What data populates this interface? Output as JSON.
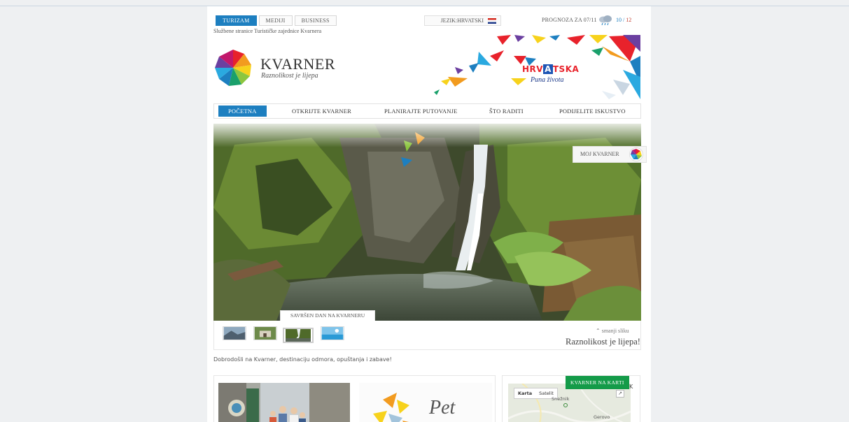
{
  "top_tabs": [
    "TURIZAM",
    "MEDIJI",
    "BUSINESS"
  ],
  "tagline": "Službene stranice Turističke zajednice Kvarnera",
  "language": {
    "label": "JEZIK:HRVATSKI"
  },
  "forecast": {
    "label": "PROGNOZA ZA 07/11",
    "low": "10",
    "separator": " / ",
    "high": "12"
  },
  "brand": {
    "name": "KVARNER",
    "slogan": "Raznolikost je lijepa"
  },
  "banner": {
    "hrv_pre": "HRV",
    "hrv_a": "A",
    "hrv_post": "TSKA",
    "slogan": "Puna života"
  },
  "nav": {
    "items": [
      "POČETNA",
      "OTKRIJTE KVARNER",
      "PLANIRAJTE PUTOVANJE",
      "ŠTO RADITI",
      "PODIJELITE ISKUSTVO"
    ],
    "active": 0
  },
  "hero": {
    "moj_label": "MOJ KVARNER",
    "caption": "SAVRŠEN DAN NA KVARNERU",
    "shrink_label": "smanji sliku",
    "slogan": "Raznolikost je lijepa!"
  },
  "welcome": "Dobrodošli na Kvarner, destinaciju odmora, opuštanja i zabave!",
  "promo": {
    "title": "Pet"
  },
  "map": {
    "button": "KVARNER NA KARTI",
    "controls": [
      "Karta",
      "Satelit"
    ],
    "labels": [
      "Snežnik",
      "Gerovo"
    ],
    "corner": "K"
  },
  "colors": {
    "accent": "#1d7fc0",
    "map_green": "#149b49",
    "temp_high": "#c0392b"
  }
}
